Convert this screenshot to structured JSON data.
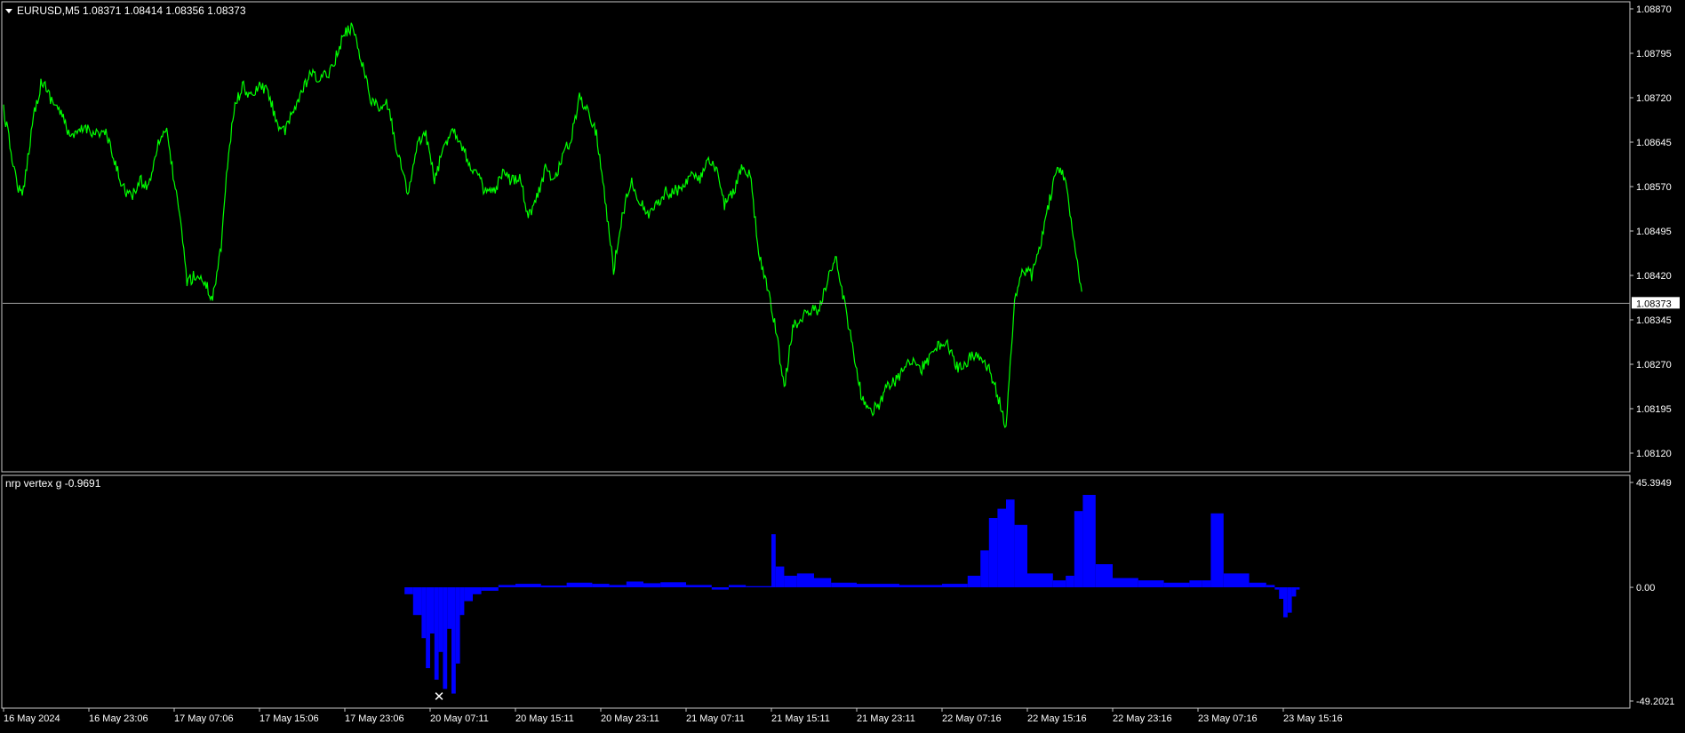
{
  "colors": {
    "background": "#000000",
    "frame": "#c8c8c8",
    "price_line": "#00ff00",
    "current_price_line": "#a0a0a0",
    "indicator_fill": "#0000ff",
    "text": "#ffffff",
    "marker": "#ffffff"
  },
  "main_panel": {
    "title_icon": "triangle-down-icon",
    "title": "EURUSD,M5  1.08371 1.08414 1.08356 1.08373",
    "current_price_label": "1.08373"
  },
  "indicator_panel": {
    "title": "nrp vertex g -0.9691",
    "marker_icon": "x-marker-icon"
  },
  "chart_data": [
    {
      "type": "line",
      "symbol": "EURUSD",
      "timeframe": "M5",
      "ohlc": {
        "open": 1.08371,
        "high": 1.08414,
        "low": 1.08356,
        "close": 1.08373
      },
      "current_price": 1.08373,
      "ylim": [
        1.0809,
        1.08882
      ],
      "y_ticks": [
        "1.08870",
        "1.08795",
        "1.08720",
        "1.08645",
        "1.08570",
        "1.08495",
        "1.08420",
        "1.08345",
        "1.08270",
        "1.08195",
        "1.08120"
      ],
      "x_ticks": [
        "16 May 2024",
        "16 May 23:06",
        "17 May 07:06",
        "17 May 15:06",
        "17 May 23:06",
        "20 May 07:11",
        "20 May 15:11",
        "20 May 23:11",
        "21 May 07:11",
        "21 May 15:11",
        "21 May 23:11",
        "22 May 07:16",
        "22 May 15:16",
        "22 May 23:16",
        "23 May 07:16",
        "23 May 15:16"
      ],
      "x_tick_index": [
        0,
        1,
        2,
        3,
        4,
        5,
        6,
        7,
        8,
        9,
        10,
        11,
        12,
        13,
        14,
        15
      ],
      "x": [
        0,
        0.05,
        0.15,
        0.22,
        0.35,
        0.45,
        0.55,
        0.65,
        0.8,
        0.95,
        1.1,
        1.2,
        1.3,
        1.4,
        1.5,
        1.6,
        1.7,
        1.8,
        1.9,
        2.0,
        2.1,
        2.15,
        2.25,
        2.35,
        2.45,
        2.55,
        2.6,
        2.7,
        2.8,
        2.9,
        3.0,
        3.1,
        3.2,
        3.3,
        3.4,
        3.5,
        3.6,
        3.7,
        3.8,
        3.9,
        4.0,
        4.1,
        4.2,
        4.3,
        4.4,
        4.5,
        4.6,
        4.7,
        4.75,
        4.85,
        4.95,
        5.05,
        5.15,
        5.25,
        5.35,
        5.45,
        5.55,
        5.65,
        5.75,
        5.85,
        5.95,
        6.05,
        6.15,
        6.25,
        6.35,
        6.45,
        6.55,
        6.65,
        6.75,
        6.85,
        6.95,
        7.05,
        7.15,
        7.25,
        7.35,
        7.45,
        7.55,
        7.65,
        7.75,
        7.85,
        7.95,
        8.05,
        8.15,
        8.25,
        8.35,
        8.45,
        8.55,
        8.65,
        8.75,
        8.85,
        8.95,
        9.05,
        9.15,
        9.25,
        9.35,
        9.45,
        9.55,
        9.65,
        9.75,
        9.85,
        9.95,
        10.05,
        10.15,
        10.25,
        10.35,
        10.45,
        10.55,
        10.65,
        10.75,
        10.85,
        10.95,
        11.05,
        11.15,
        11.25,
        11.35,
        11.45,
        11.55,
        11.65,
        11.75,
        11.85,
        11.95,
        12.05,
        12.15,
        12.25,
        12.35,
        12.45,
        12.55,
        12.65,
        12.75,
        12.85,
        12.95,
        13.05,
        13.15,
        13.25,
        13.35,
        13.45,
        13.55,
        13.65,
        13.75,
        13.85,
        13.95,
        14.05,
        14.15,
        14.25,
        14.35,
        14.45,
        14.55,
        14.65,
        14.75,
        14.85,
        14.95,
        15.05,
        15.1,
        15.15,
        15.2,
        15.25
      ],
      "y": [
        1.087,
        1.0866,
        1.0858,
        1.0855,
        1.0869,
        1.0875,
        1.0872,
        1.087,
        1.0865,
        1.0867,
        1.0866,
        1.0866,
        1.0861,
        1.0857,
        1.0855,
        1.0858,
        1.0857,
        1.0864,
        1.0867,
        1.0858,
        1.0848,
        1.0841,
        1.0842,
        1.0841,
        1.0838,
        1.0847,
        1.0857,
        1.087,
        1.0874,
        1.0872,
        1.0874,
        1.0873,
        1.0868,
        1.0866,
        1.087,
        1.0873,
        1.0876,
        1.0875,
        1.0876,
        1.0879,
        1.0883,
        1.0884,
        1.0878,
        1.0872,
        1.087,
        1.0871,
        1.0864,
        1.0858,
        1.0856,
        1.0864,
        1.0866,
        1.0858,
        1.0863,
        1.0867,
        1.0865,
        1.0861,
        1.0859,
        1.0856,
        1.0856,
        1.0859,
        1.0858,
        1.0859,
        1.0852,
        1.0855,
        1.086,
        1.0858,
        1.0862,
        1.0865,
        1.0872,
        1.087,
        1.0866,
        1.0855,
        1.0843,
        1.0852,
        1.0858,
        1.0855,
        1.0852,
        1.0854,
        1.0856,
        1.0856,
        1.0857,
        1.0859,
        1.0858,
        1.0861,
        1.086,
        1.0854,
        1.0856,
        1.086,
        1.0859,
        1.0846,
        1.084,
        1.0833,
        1.0823,
        1.0833,
        1.0835,
        1.0836,
        1.0836,
        1.0841,
        1.0845,
        1.0838,
        1.083,
        1.0822,
        1.0819,
        1.082,
        1.0823,
        1.0824,
        1.0826,
        1.0828,
        1.0826,
        1.0828,
        1.083,
        1.0831,
        1.0827,
        1.0826,
        1.0829,
        1.0828,
        1.0826,
        1.0822,
        1.0816,
        1.0838,
        1.0843,
        1.0842,
        1.0847,
        1.0854,
        1.086,
        1.0858,
        1.0848,
        1.0838
      ]
    },
    {
      "type": "bar",
      "name": "nrp vertex g",
      "value": -0.9691,
      "ylim": [
        -49.2021,
        45.3949
      ],
      "y_ticks": [
        "45.3949",
        "0.00",
        "-49.2021"
      ],
      "x_tick_index": [
        0,
        1,
        2,
        3,
        4,
        5,
        6,
        7,
        8,
        9,
        10,
        11,
        12,
        13,
        14,
        15
      ],
      "x": [
        4.7,
        4.8,
        4.9,
        4.95,
        5.0,
        5.05,
        5.1,
        5.15,
        5.2,
        5.25,
        5.3,
        5.35,
        5.4,
        5.5,
        5.6,
        5.8,
        6.0,
        6.3,
        6.6,
        6.9,
        7.1,
        7.3,
        7.5,
        7.7,
        8.0,
        8.3,
        8.5,
        8.7,
        9.0,
        9.05,
        9.15,
        9.3,
        9.5,
        9.7,
        10.0,
        10.5,
        11.0,
        11.3,
        11.45,
        11.55,
        11.65,
        11.75,
        11.85,
        12.0,
        12.3,
        12.45,
        12.55,
        12.65,
        12.8,
        13.0,
        13.3,
        13.6,
        13.9,
        14.05,
        14.15,
        14.3,
        14.6,
        14.8,
        14.9,
        14.95,
        15.0,
        15.05,
        15.1,
        15.15
      ],
      "values": [
        -3,
        -12,
        -22,
        -35,
        -20,
        -40,
        -28,
        -44,
        -18,
        -46,
        -33,
        -12,
        -6,
        -3,
        -1.5,
        1,
        1.5,
        0.8,
        2,
        1.5,
        1,
        2.5,
        1.8,
        2.2,
        1,
        -1,
        1,
        0.5,
        23,
        9,
        5,
        6,
        4,
        2,
        1.5,
        1,
        1.5,
        5,
        16,
        30,
        34,
        38,
        27,
        6,
        3,
        5,
        33,
        40,
        10,
        4,
        3,
        2,
        3,
        3,
        32,
        6,
        2,
        1,
        -1,
        -5,
        -13,
        -11,
        -4,
        -1
      ]
    }
  ]
}
